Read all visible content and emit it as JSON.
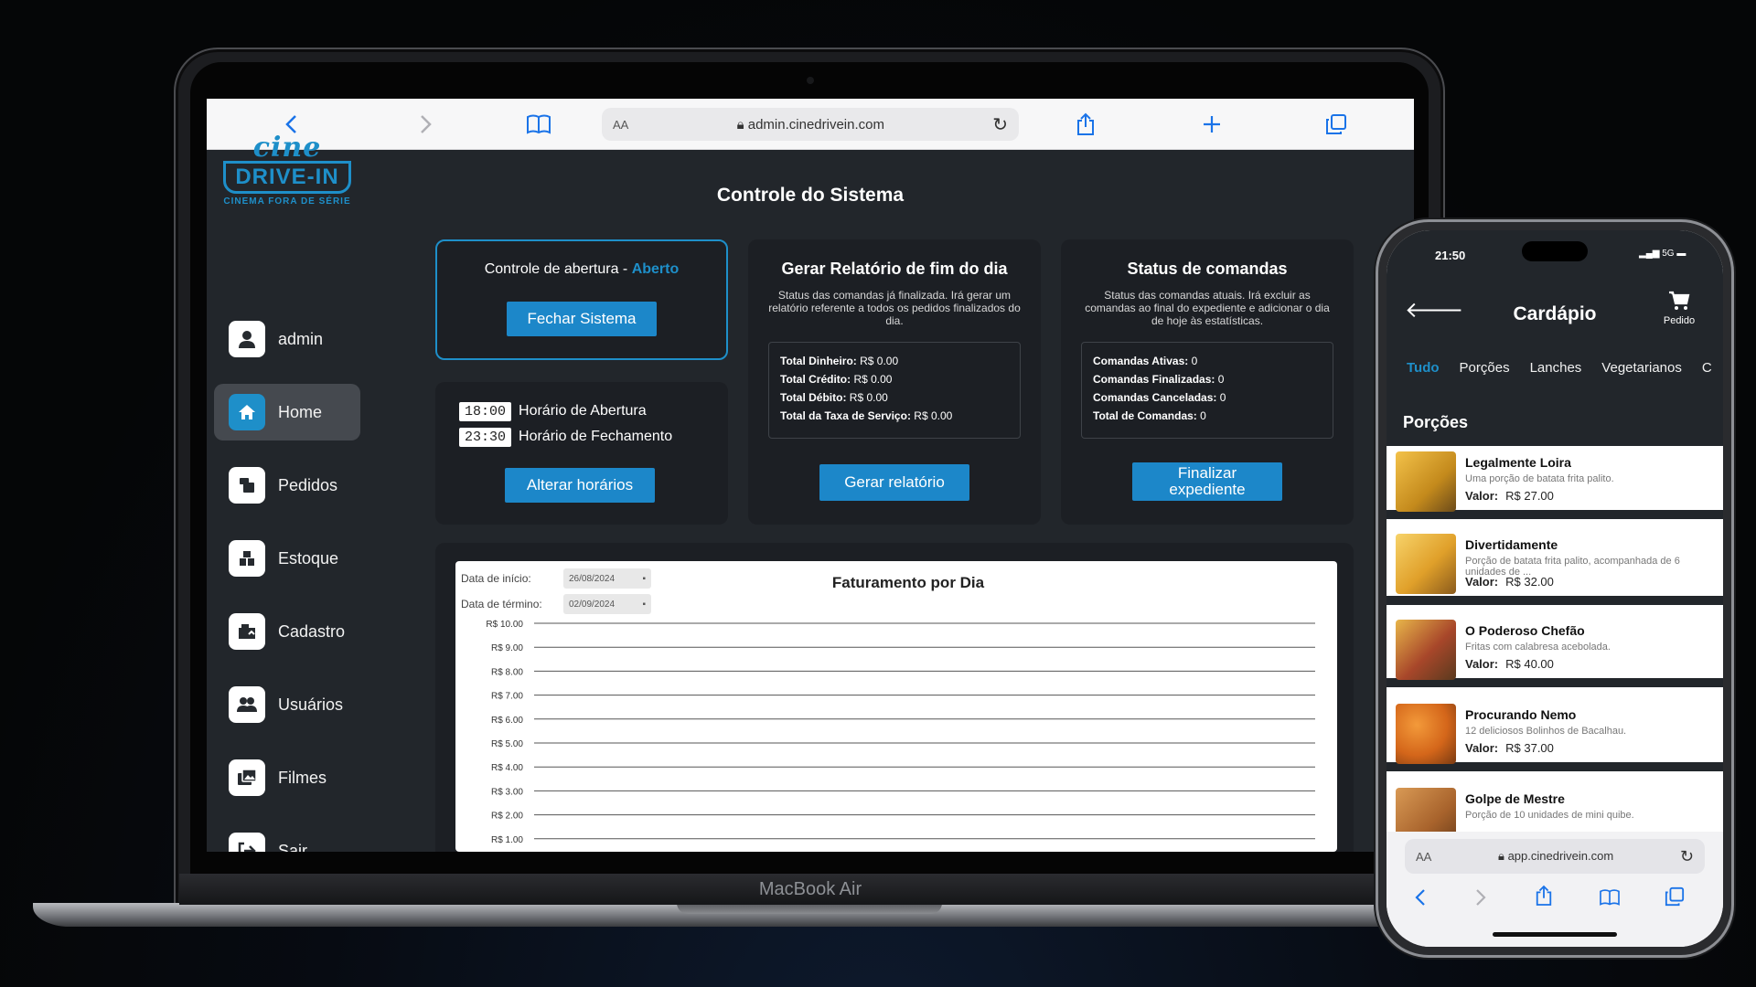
{
  "laptop": {
    "device_label": "MacBook Air",
    "browser": {
      "text_size": "AA",
      "url": "admin.cinedrivein.com"
    },
    "logo": {
      "line1": "cine",
      "line2": "DRIVE-IN",
      "tagline": "CINEMA FORA DE SÉRIE"
    },
    "sidebar": {
      "items": [
        {
          "label": "admin",
          "icon": "user-icon"
        },
        {
          "label": "Home",
          "icon": "home-icon",
          "active": true
        },
        {
          "label": "Pedidos",
          "icon": "orders-icon"
        },
        {
          "label": "Estoque",
          "icon": "stock-icon"
        },
        {
          "label": "Cadastro",
          "icon": "register-icon"
        },
        {
          "label": "Usuários",
          "icon": "users-icon"
        },
        {
          "label": "Filmes",
          "icon": "films-icon"
        },
        {
          "label": "Sair",
          "icon": "logout-icon"
        }
      ]
    },
    "main": {
      "title": "Controle do Sistema",
      "opening_control": {
        "label": "Controle de abertura - ",
        "status": "Aberto",
        "button": "Fechar Sistema"
      },
      "hours": {
        "open_time": "18:00",
        "open_label": "Horário de Abertura",
        "close_time": "23:30",
        "close_label": "Horário de Fechamento",
        "button": "Alterar horários"
      },
      "report": {
        "title": "Gerar Relatório de fim do dia",
        "desc": "Status das comandas já finalizada. Irá gerar um relatório referente a todos os pedidos finalizados do dia.",
        "rows": [
          {
            "label": "Total Dinheiro:",
            "value": "R$ 0.00"
          },
          {
            "label": "Total Crédito:",
            "value": "R$ 0.00"
          },
          {
            "label": "Total Débito:",
            "value": "R$ 0.00"
          },
          {
            "label": "Total da Taxa de Serviço:",
            "value": "R$ 0.00"
          }
        ],
        "button": "Gerar relatório"
      },
      "orders_status": {
        "title": "Status de comandas",
        "desc": "Status das comandas atuais. Irá excluir as comandas ao final do expediente e adicionar o dia de hoje às estatísticas.",
        "rows": [
          {
            "label": "Comandas Ativas:",
            "value": "0"
          },
          {
            "label": "Comandas Finalizadas:",
            "value": "0"
          },
          {
            "label": "Comandas Canceladas:",
            "value": "0"
          },
          {
            "label": "Total de Comandas:",
            "value": "0"
          }
        ],
        "button_line1": "Finalizar",
        "button_line2": "expediente"
      },
      "revenue": {
        "start_label": "Data de início:",
        "start_value": "26/08/2024",
        "end_label": "Data de término:",
        "end_value": "02/09/2024"
      }
    }
  },
  "chart_data": {
    "type": "line",
    "title": "Faturamento por Dia",
    "yticks": [
      "R$ 10.00",
      "R$ 9.00",
      "R$ 8.00",
      "R$ 7.00",
      "R$ 6.00",
      "R$ 5.00",
      "R$ 4.00",
      "R$ 3.00",
      "R$ 2.00",
      "R$ 1.00"
    ],
    "ylim": [
      1,
      10
    ],
    "grid": true,
    "series": []
  },
  "phone": {
    "time": "21:50",
    "network": "5G",
    "header": {
      "title": "Cardápio",
      "cart_label": "Pedido"
    },
    "tabs": [
      "Tudo",
      "Porções",
      "Lanches",
      "Vegetarianos",
      "C"
    ],
    "section": "Porções",
    "price_label": "Valor:",
    "items": [
      {
        "name": "Legalmente Loira",
        "desc": "Uma porção de batata frita palito.",
        "price": "R$ 27.00"
      },
      {
        "name": "Divertidamente",
        "desc": "Porção de batata frita palito, acompanhada de 6 unidades de ...",
        "price": "R$ 32.00"
      },
      {
        "name": "O Poderoso Chefão",
        "desc": "Fritas com calabresa acebolada.",
        "price": "R$ 40.00"
      },
      {
        "name": "Procurando Nemo",
        "desc": "12 deliciosos Bolinhos de Bacalhau.",
        "price": "R$ 37.00"
      },
      {
        "name": "Golpe de Mestre",
        "desc": "Porção de 10 unidades de mini quibe.",
        "price": ""
      }
    ],
    "browser": {
      "text_size": "AA",
      "url": "app.cinedrivein.com"
    }
  },
  "colors": {
    "accent": "#1e8fc9",
    "panel": "#1c1f24",
    "screen_bg": "#22262b"
  }
}
